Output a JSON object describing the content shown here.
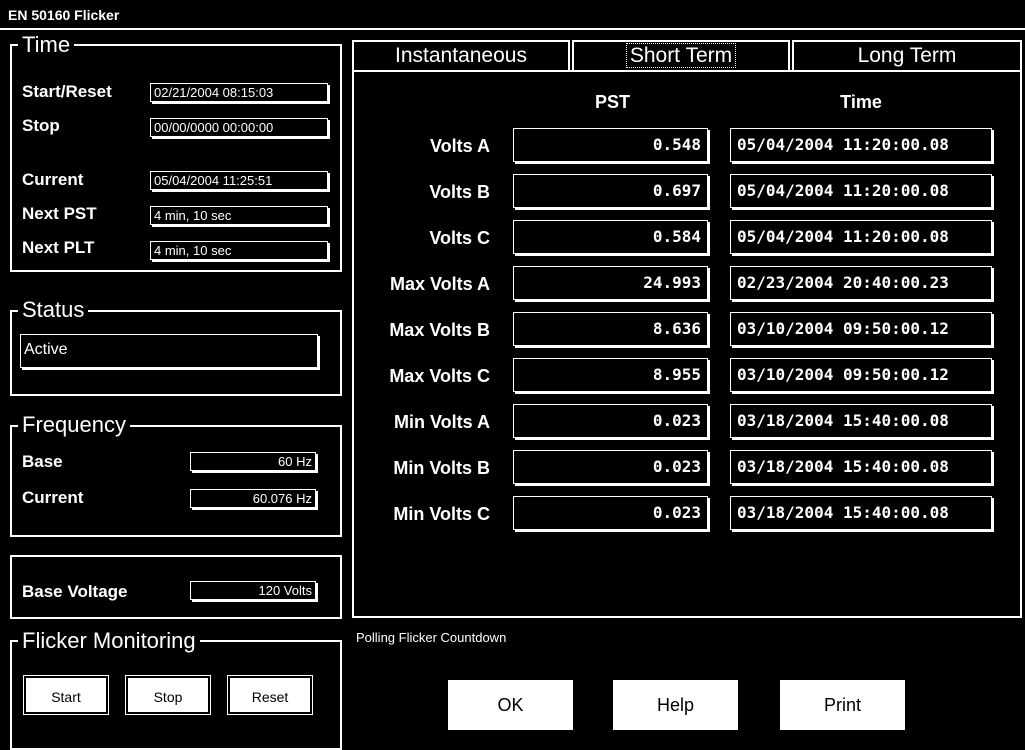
{
  "window": {
    "title": "EN 50160 Flicker"
  },
  "time": {
    "title": "Time",
    "start_label": "Start/Reset",
    "start_value": "02/21/2004 08:15:03",
    "stop_label": "Stop",
    "stop_value": "00/00/0000 00:00:00",
    "current_label": "Current",
    "current_value": "05/04/2004 11:25:51",
    "next_pst_label": "Next PST",
    "next_pst_value": "4 min, 10 sec",
    "next_plt_label": "Next PLT",
    "next_plt_value": "4 min, 10 sec"
  },
  "status": {
    "title": "Status",
    "value": "Active"
  },
  "frequency": {
    "title": "Frequency",
    "base_label": "Base",
    "base_value": "60 Hz",
    "current_label": "Current",
    "current_value": "60.076 Hz"
  },
  "base_voltage": {
    "label": "Base Voltage",
    "value": "120 Volts"
  },
  "monitoring": {
    "title": "Flicker Monitoring",
    "start": "Start",
    "stop": "Stop",
    "reset": "Reset"
  },
  "tabs": [
    {
      "label": "Instantaneous",
      "active": false
    },
    {
      "label": "Short Term",
      "active": true
    },
    {
      "label": "Long Term",
      "active": false
    }
  ],
  "table": {
    "col_pst": "PST",
    "col_time": "Time",
    "rows": [
      {
        "label": "Volts A",
        "pst": "0.548",
        "time": "05/04/2004 11:20:00.08"
      },
      {
        "label": "Volts B",
        "pst": "0.697",
        "time": "05/04/2004 11:20:00.08"
      },
      {
        "label": "Volts C",
        "pst": "0.584",
        "time": "05/04/2004 11:20:00.08"
      },
      {
        "label": "Max Volts A",
        "pst": "24.993",
        "time": "02/23/2004 20:40:00.23"
      },
      {
        "label": "Max Volts B",
        "pst": "8.636",
        "time": "03/10/2004 09:50:00.12"
      },
      {
        "label": "Max Volts C",
        "pst": "8.955",
        "time": "03/10/2004 09:50:00.12"
      },
      {
        "label": "Min Volts A",
        "pst": "0.023",
        "time": "03/18/2004 15:40:00.08"
      },
      {
        "label": "Min Volts B",
        "pst": "0.023",
        "time": "03/18/2004 15:40:00.08"
      },
      {
        "label": "Min Volts C",
        "pst": "0.023",
        "time": "03/18/2004 15:40:00.08"
      }
    ]
  },
  "polling_text": "Polling Flicker Countdown",
  "buttons": {
    "ok": "OK",
    "help": "Help",
    "print": "Print"
  }
}
